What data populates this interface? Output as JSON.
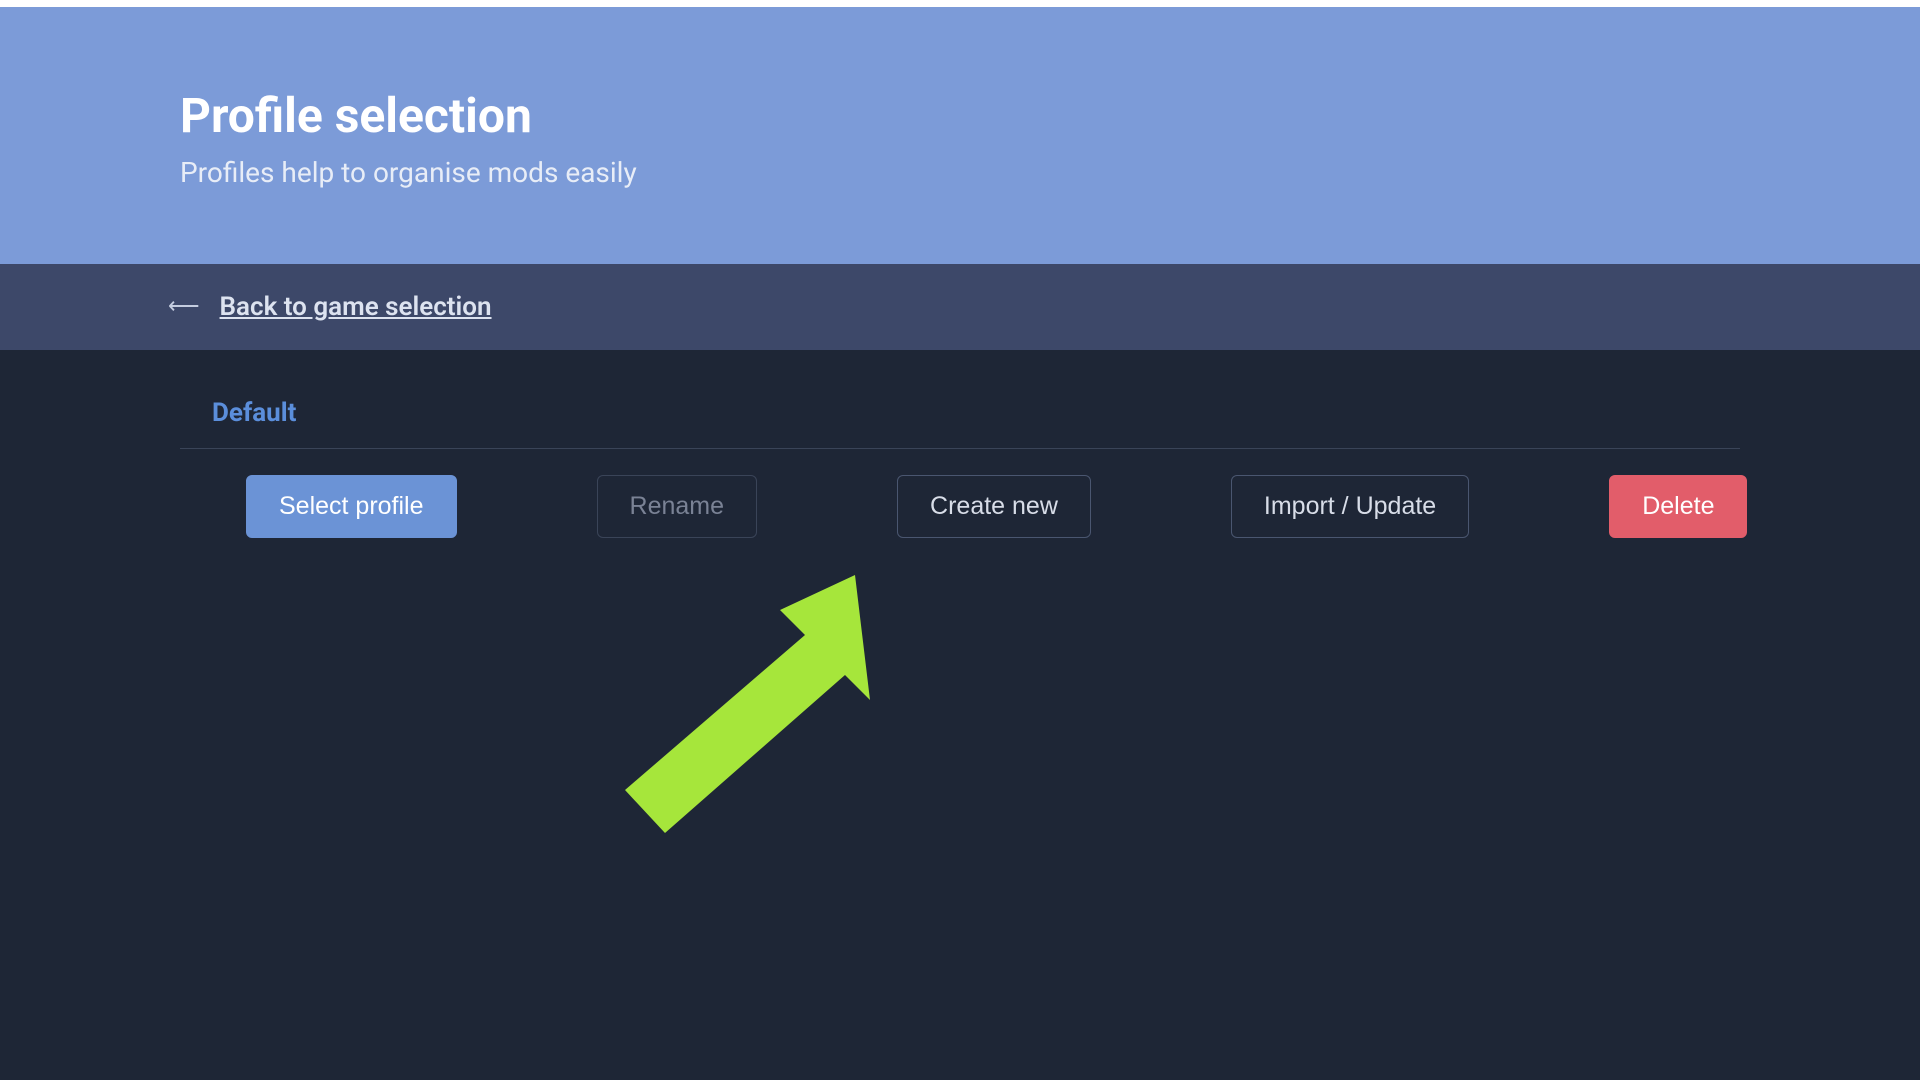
{
  "header": {
    "title": "Profile selection",
    "subtitle": "Profiles help to organise mods easily"
  },
  "nav": {
    "back_label": "Back to game selection"
  },
  "profile": {
    "name": "Default"
  },
  "buttons": {
    "select": "Select profile",
    "rename": "Rename",
    "create": "Create new",
    "import": "Import / Update",
    "delete": "Delete"
  },
  "annotation": {
    "arrow_color": "#a6e63b"
  }
}
